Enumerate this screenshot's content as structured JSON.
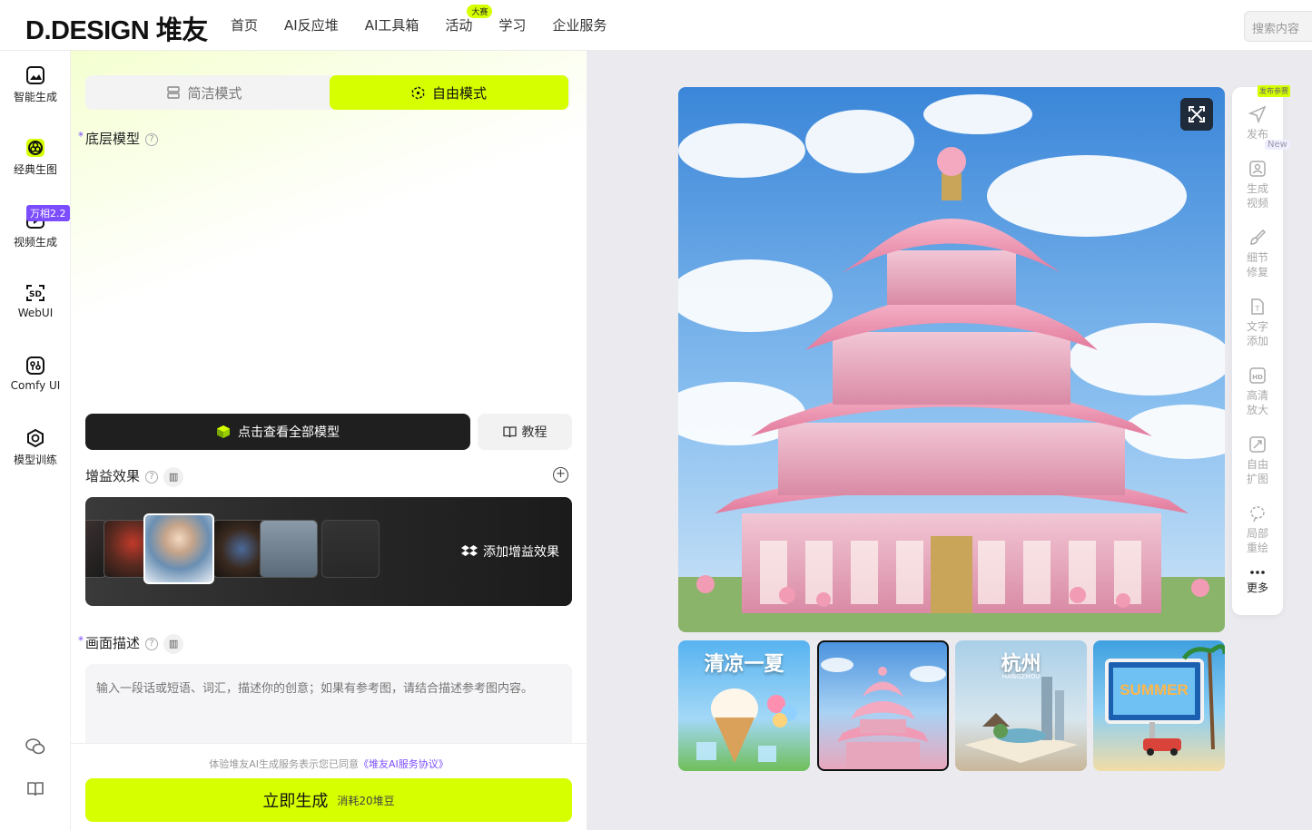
{
  "header": {
    "logo": "D.DESIGN 堆友",
    "nav": [
      "首页",
      "AI反应堆",
      "AI工具箱",
      "活动",
      "学习",
      "企业服务"
    ],
    "activity_badge": "大赛",
    "search_placeholder": "搜索内容"
  },
  "sidebar": {
    "items": [
      {
        "label": "智能生成",
        "icon": "image-sparkle-icon"
      },
      {
        "label": "经典生图",
        "icon": "classic-image-icon"
      },
      {
        "label": "视频生成",
        "icon": "video-icon",
        "badge": "万相2.2"
      },
      {
        "label": "WebUI",
        "icon": "sd-icon"
      },
      {
        "label": "Comfy UI",
        "icon": "comfy-icon"
      },
      {
        "label": "模型训练",
        "icon": "model-train-icon"
      }
    ],
    "bottom_icons": [
      "wechat-icon",
      "book-icon"
    ]
  },
  "panel": {
    "mode_simple": "简洁模式",
    "mode_free": "自由模式",
    "base_model_label": "底层模型",
    "view_all_models": "点击查看全部模型",
    "tutorial": "教程",
    "boost_label": "增益效果",
    "add_boost": "添加增益效果",
    "desc_label": "画面描述",
    "desc_placeholder": "输入一段话或短语、词汇，描述你的创意；如果有参考图，请结合描述参考图内容。",
    "agree_text": "体验堆友AI生成服务表示您已同意",
    "agree_link": "《堆友AI服务协议》",
    "generate": "立即生成",
    "cost": "消耗20堆豆"
  },
  "preview": {
    "thumbnails": [
      {
        "title": "清凉一夏"
      },
      {
        "title": ""
      },
      {
        "title": "杭州",
        "subtitle": "HANGZHOU"
      },
      {
        "title": "SUMMER"
      }
    ]
  },
  "tools": {
    "publish_badge": "发布参赛",
    "new_badge": "New",
    "items": [
      {
        "label": "发布",
        "icon": "send-icon"
      },
      {
        "label": "生成视频",
        "icon": "video-gen-icon"
      },
      {
        "label": "细节修复",
        "icon": "brush-icon"
      },
      {
        "label": "文字添加",
        "icon": "text-file-icon"
      },
      {
        "label": "高清放大",
        "icon": "hd-icon"
      },
      {
        "label": "自由扩图",
        "icon": "expand-image-icon"
      },
      {
        "label": "局部重绘",
        "icon": "lasso-icon"
      },
      {
        "label": "更多",
        "icon": "more-icon"
      }
    ]
  }
}
